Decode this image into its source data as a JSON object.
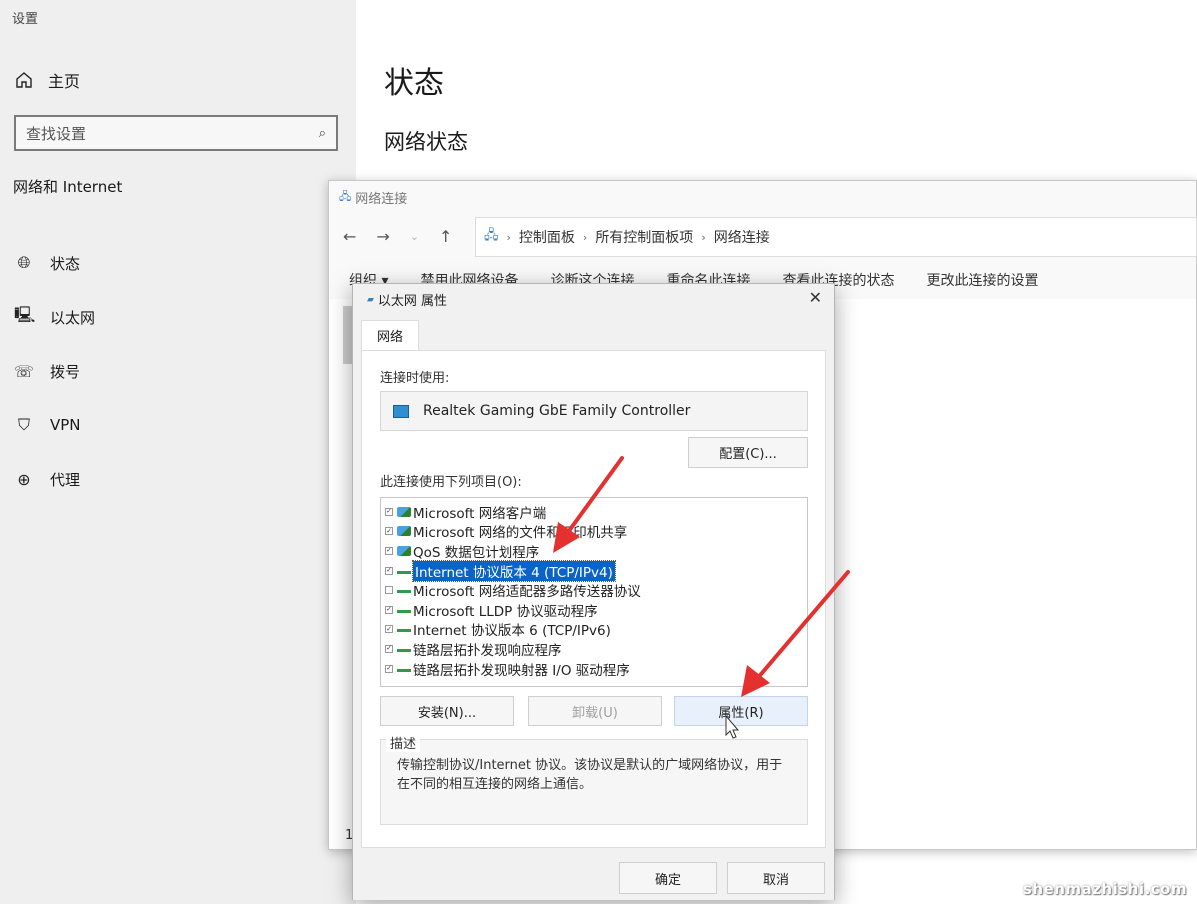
{
  "settings": {
    "app_title": "设置",
    "home_label": "主页",
    "search_placeholder": "查找设置",
    "section_title": "网络和 Internet",
    "nav": [
      {
        "label": "状态",
        "icon": "globe-status-icon"
      },
      {
        "label": "以太网",
        "icon": "ethernet-icon"
      },
      {
        "label": "拨号",
        "icon": "dialup-icon"
      },
      {
        "label": "VPN",
        "icon": "vpn-shield-icon"
      },
      {
        "label": "代理",
        "icon": "proxy-globe-icon"
      }
    ],
    "page_title": "状态",
    "section_heading": "网络状态"
  },
  "explorer": {
    "title": "网络连接",
    "breadcrumb": [
      "控制面板",
      "所有控制面板项",
      "网络连接"
    ],
    "toolbar": [
      "组织 ▾",
      "禁用此网络设备",
      "诊断这个连接",
      "重命名此连接",
      "查看此连接的状态",
      "更改此连接的设置"
    ],
    "status_count": "1"
  },
  "dialog": {
    "title": "以太网 属性",
    "tab_label": "网络",
    "connect_using_label": "连接时使用:",
    "adapter_name": "Realtek Gaming GbE Family Controller",
    "configure_button": "配置(C)...",
    "items_label": "此连接使用下列项目(O):",
    "items": [
      {
        "label": "Microsoft 网络客户端",
        "checked": true,
        "icon": "blue",
        "selected": false
      },
      {
        "label": "Microsoft 网络的文件和打印机共享",
        "checked": true,
        "icon": "blue",
        "selected": false
      },
      {
        "label": "QoS 数据包计划程序",
        "checked": true,
        "icon": "blue",
        "selected": false
      },
      {
        "label": "Internet 协议版本 4 (TCP/IPv4)",
        "checked": true,
        "icon": "green",
        "selected": true
      },
      {
        "label": "Microsoft 网络适配器多路传送器协议",
        "checked": false,
        "icon": "green",
        "selected": false
      },
      {
        "label": "Microsoft LLDP 协议驱动程序",
        "checked": true,
        "icon": "green",
        "selected": false
      },
      {
        "label": "Internet 协议版本 6 (TCP/IPv6)",
        "checked": true,
        "icon": "green",
        "selected": false
      },
      {
        "label": "链路层拓扑发现响应程序",
        "checked": true,
        "icon": "green",
        "selected": false
      },
      {
        "label": "链路层拓扑发现映射器 I/O 驱动程序",
        "checked": true,
        "icon": "green",
        "selected": false
      }
    ],
    "install_button": "安装(N)...",
    "uninstall_button": "卸载(U)",
    "properties_button": "属性(R)",
    "description_label": "描述",
    "description_text": "传输控制协议/Internet 协议。该协议是默认的广域网络协议，用于在不同的相互连接的网络上通信。",
    "ok_button": "确定",
    "cancel_button": "取消"
  },
  "watermark": "shenmazhishi.com",
  "colors": {
    "selection": "#0a64c8",
    "arrow": "#e53030"
  }
}
